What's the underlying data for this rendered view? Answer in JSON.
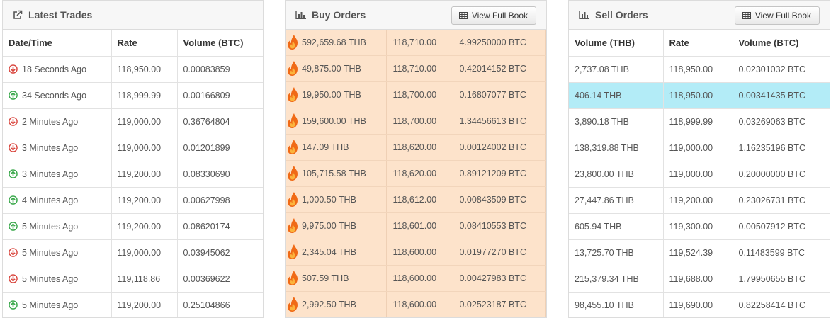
{
  "colors": {
    "up": "#3aa84b",
    "down": "#d9463e",
    "buy_row_bg": "#fde3cb",
    "sell_highlight_bg": "#b3ecf7"
  },
  "latest_trades": {
    "title": "Latest Trades",
    "icon": "external-link-icon",
    "headers": [
      "Date/Time",
      "Rate",
      "Volume (BTC)"
    ],
    "rows": [
      {
        "direction": "down",
        "time": "18 Seconds Ago",
        "rate": "118,950.00",
        "volume": "0.00083859"
      },
      {
        "direction": "up",
        "time": "34 Seconds Ago",
        "rate": "118,999.99",
        "volume": "0.00166809"
      },
      {
        "direction": "down",
        "time": "2 Minutes Ago",
        "rate": "119,000.00",
        "volume": "0.36764804"
      },
      {
        "direction": "down",
        "time": "3 Minutes Ago",
        "rate": "119,000.00",
        "volume": "0.01201899"
      },
      {
        "direction": "up",
        "time": "3 Minutes Ago",
        "rate": "119,200.00",
        "volume": "0.08330690"
      },
      {
        "direction": "up",
        "time": "4 Minutes Ago",
        "rate": "119,200.00",
        "volume": "0.00627998"
      },
      {
        "direction": "up",
        "time": "5 Minutes Ago",
        "rate": "119,200.00",
        "volume": "0.08620174"
      },
      {
        "direction": "down",
        "time": "5 Minutes Ago",
        "rate": "119,000.00",
        "volume": "0.03945062"
      },
      {
        "direction": "down",
        "time": "5 Minutes Ago",
        "rate": "119,118.86",
        "volume": "0.00369622"
      },
      {
        "direction": "up",
        "time": "5 Minutes Ago",
        "rate": "119,200.00",
        "volume": "0.25104866"
      }
    ]
  },
  "buy_orders": {
    "title": "Buy Orders",
    "icon": "bar-chart-icon",
    "button_label": "View Full Book",
    "button_icon": "table-icon",
    "row_icon": "fire-icon",
    "rows": [
      {
        "amount": "592,659.68 THB",
        "rate": "118,710.00",
        "volume": "4.99250000 BTC"
      },
      {
        "amount": "49,875.00 THB",
        "rate": "118,710.00",
        "volume": "0.42014152 BTC"
      },
      {
        "amount": "19,950.00 THB",
        "rate": "118,700.00",
        "volume": "0.16807077 BTC"
      },
      {
        "amount": "159,600.00 THB",
        "rate": "118,700.00",
        "volume": "1.34456613 BTC"
      },
      {
        "amount": "147.09 THB",
        "rate": "118,620.00",
        "volume": "0.00124002 BTC"
      },
      {
        "amount": "105,715.58 THB",
        "rate": "118,620.00",
        "volume": "0.89121209 BTC"
      },
      {
        "amount": "1,000.50 THB",
        "rate": "118,612.00",
        "volume": "0.00843509 BTC"
      },
      {
        "amount": "9,975.00 THB",
        "rate": "118,601.00",
        "volume": "0.08410553 BTC"
      },
      {
        "amount": "2,345.04 THB",
        "rate": "118,600.00",
        "volume": "0.01977270 BTC"
      },
      {
        "amount": "507.59 THB",
        "rate": "118,600.00",
        "volume": "0.00427983 BTC"
      },
      {
        "amount": "2,992.50 THB",
        "rate": "118,600.00",
        "volume": "0.02523187 BTC"
      }
    ]
  },
  "sell_orders": {
    "title": "Sell Orders",
    "icon": "bar-chart-icon",
    "button_label": "View Full Book",
    "button_icon": "table-icon",
    "headers": [
      "Volume (THB)",
      "Rate",
      "Volume (BTC)"
    ],
    "rows": [
      {
        "amount": "2,737.08 THB",
        "rate": "118,950.00",
        "volume": "0.02301032 BTC",
        "highlighted": false
      },
      {
        "amount": "406.14 THB",
        "rate": "118,950.00",
        "volume": "0.00341435 BTC",
        "highlighted": true
      },
      {
        "amount": "3,890.18 THB",
        "rate": "118,999.99",
        "volume": "0.03269063 BTC",
        "highlighted": false
      },
      {
        "amount": "138,319.88 THB",
        "rate": "119,000.00",
        "volume": "1.16235196 BTC",
        "highlighted": false
      },
      {
        "amount": "23,800.00 THB",
        "rate": "119,000.00",
        "volume": "0.20000000 BTC",
        "highlighted": false
      },
      {
        "amount": "27,447.86 THB",
        "rate": "119,200.00",
        "volume": "0.23026731 BTC",
        "highlighted": false
      },
      {
        "amount": "605.94 THB",
        "rate": "119,300.00",
        "volume": "0.00507912 BTC",
        "highlighted": false
      },
      {
        "amount": "13,725.70 THB",
        "rate": "119,524.39",
        "volume": "0.11483599 BTC",
        "highlighted": false
      },
      {
        "amount": "215,379.34 THB",
        "rate": "119,688.00",
        "volume": "1.79950655 BTC",
        "highlighted": false
      },
      {
        "amount": "98,455.10 THB",
        "rate": "119,690.00",
        "volume": "0.82258414 BTC",
        "highlighted": false
      }
    ]
  }
}
